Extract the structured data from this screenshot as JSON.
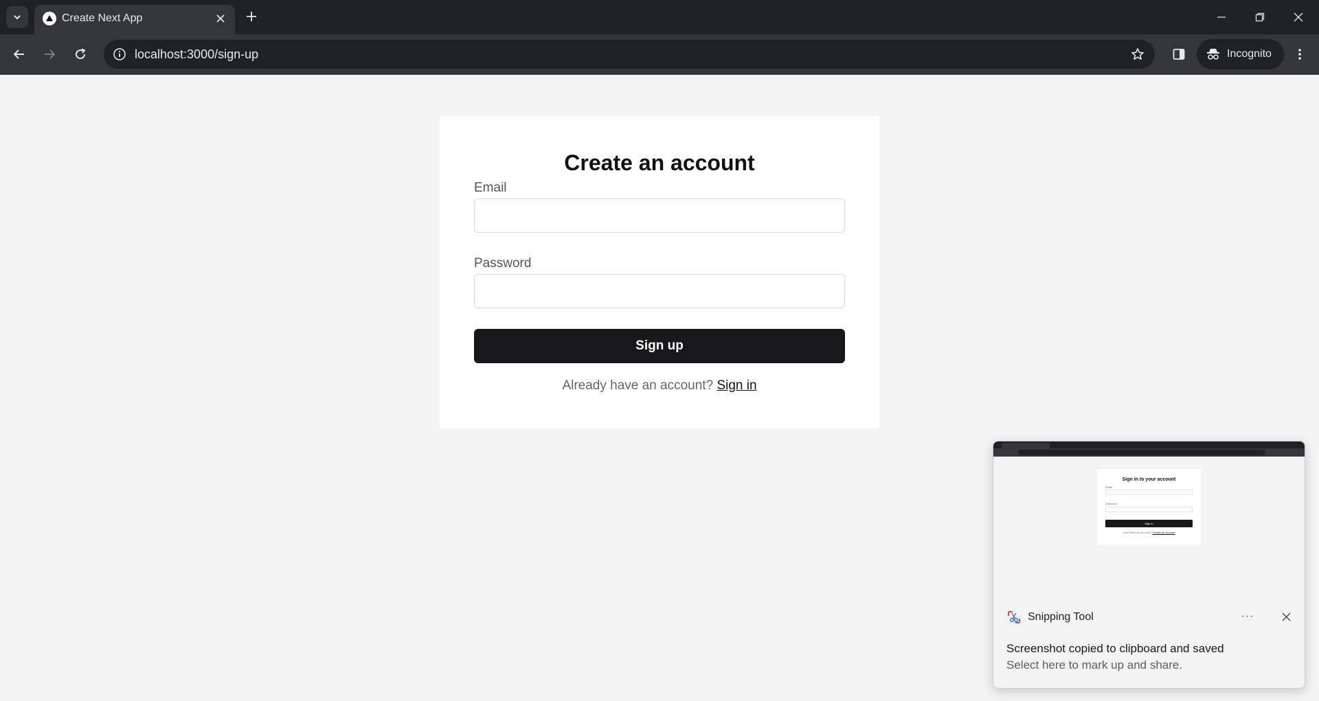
{
  "browser": {
    "tab_title": "Create Next App",
    "url": "localhost:3000/sign-up",
    "profile_label": "Incognito"
  },
  "signup": {
    "title": "Create an account",
    "email_label": "Email",
    "email_value": "",
    "password_label": "Password",
    "password_value": "",
    "submit_label": "Sign up",
    "footer_text": "Already have an account?",
    "footer_link": "Sign in"
  },
  "toast": {
    "app_name": "Snipping Tool",
    "more_label": "···",
    "message": "Screenshot copied to clipboard and saved",
    "subtext": "Select here to mark up and share.",
    "preview": {
      "title": "Sign in to your account",
      "email_label": "Email",
      "password_label": "Password",
      "button_label": "Sign in",
      "footer_text": "Don't have an account?",
      "footer_link": "Create an account"
    }
  },
  "colors": {
    "page_bg": "#f4f4f4",
    "chrome_dark": "#202124",
    "chrome_mid": "#35363a",
    "button_bg": "#18181b"
  }
}
